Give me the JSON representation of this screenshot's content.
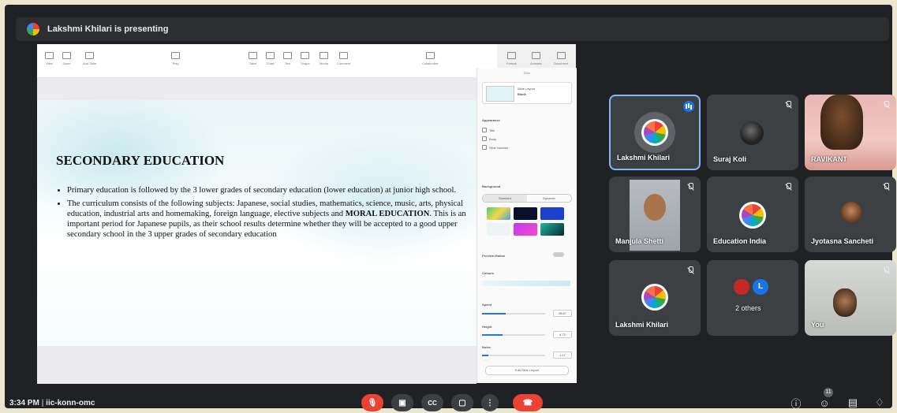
{
  "meeting": {
    "presenting_text": "Lakshmi Khilari is presenting",
    "time": "3:34 PM",
    "separator": "|",
    "meeting_code": "iic-konn-omc",
    "participant_count": "11"
  },
  "slide": {
    "title": "SECONDARY EDUCATION",
    "bullet1": "Primary education is followed by the 3 lower grades of secondary education (lower education) at junior high school.",
    "bullet2_part1": "The curriculum consists of the following subjects: Japanese, social studies, mathematics, science, music, arts, physical education, industrial arts and homemaking, foreign language, elective subjects and ",
    "bullet2_bold": "MORAL EDUCATION",
    "bullet2_part2": ". This is an important period for Japanese pupils, as their school results determine whether they will be accepted to a good upper secondary school in the 3 upper grades of secondary education"
  },
  "editor": {
    "toolbar": [
      "View",
      "Zoom",
      "Add Slide",
      "",
      "Play",
      "Table",
      "Chart",
      "Text",
      "Shape",
      "Media",
      "Comment",
      "Collaborate",
      "Format",
      "Animate",
      "Document"
    ],
    "panel": {
      "title": "Slide",
      "layout_label": "Slide Layout",
      "layout_value": "Blank",
      "appearance": "Appearance",
      "title_opt": "Title",
      "body_opt": "Body",
      "slide_number": "Slide Number",
      "background": "Background",
      "standard": "Standard",
      "dynamic": "Dynamic",
      "preview_motion": "Preview Motion",
      "colours": "Colours",
      "speed": "Speed",
      "speed_value": "28.67",
      "height": "Height",
      "height_value": "4.72",
      "noise": "Noise",
      "noise_value": "1.17",
      "edit_layout": "Edit Slide Layout"
    }
  },
  "participants": [
    {
      "name": "Lakshmi Khilari",
      "speaking": true
    },
    {
      "name": "Suraj Koli",
      "initial": ""
    },
    {
      "name": "RAVIKANT"
    },
    {
      "name": "Manjula Shetti"
    },
    {
      "name": "Education India"
    },
    {
      "name": "Jyotasna Sancheti"
    },
    {
      "name": "Lakshmi Khilari"
    },
    {
      "name": "2 others",
      "initial": "L"
    },
    {
      "name": "You"
    }
  ],
  "colors": {
    "accent": "#8ab4f8",
    "tile_bg": "#3c4043",
    "end_call": "#ea4335",
    "frame": "#202124"
  },
  "icons": [
    "mic-off-icon",
    "camera-icon",
    "captions-icon",
    "present-icon",
    "more-icon",
    "end-call-icon",
    "info-icon",
    "people-icon",
    "chat-icon",
    "activities-icon"
  ]
}
